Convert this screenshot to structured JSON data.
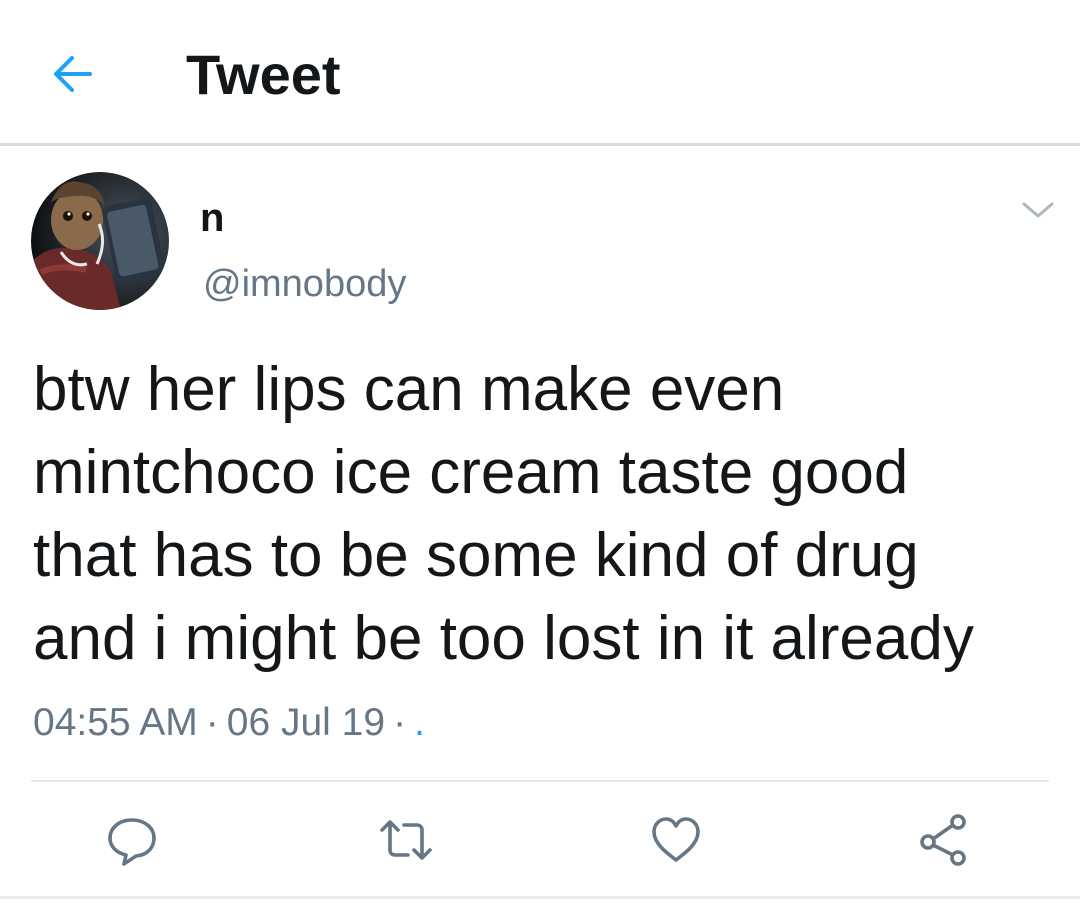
{
  "header": {
    "title": "Tweet",
    "back_icon": "arrow-left-icon"
  },
  "colors": {
    "accent": "#1da1f2",
    "text": "#14171a",
    "secondary": "#657786",
    "divider": "#e1e8ed"
  },
  "tweet": {
    "display_name": "n",
    "handle": "@imnobody",
    "text_lines": [
      "btw her lips can make even",
      "mintchoco ice cream taste good",
      "that has to be some kind of drug",
      "and i might be too lost in it already"
    ],
    "time": "04:55 AM",
    "separator": "·",
    "date": "06 Jul 19",
    "source": "."
  },
  "actions": [
    {
      "name": "reply",
      "icon": "reply-icon"
    },
    {
      "name": "retweet",
      "icon": "retweet-icon"
    },
    {
      "name": "like",
      "icon": "heart-icon"
    },
    {
      "name": "share",
      "icon": "share-icon"
    }
  ]
}
